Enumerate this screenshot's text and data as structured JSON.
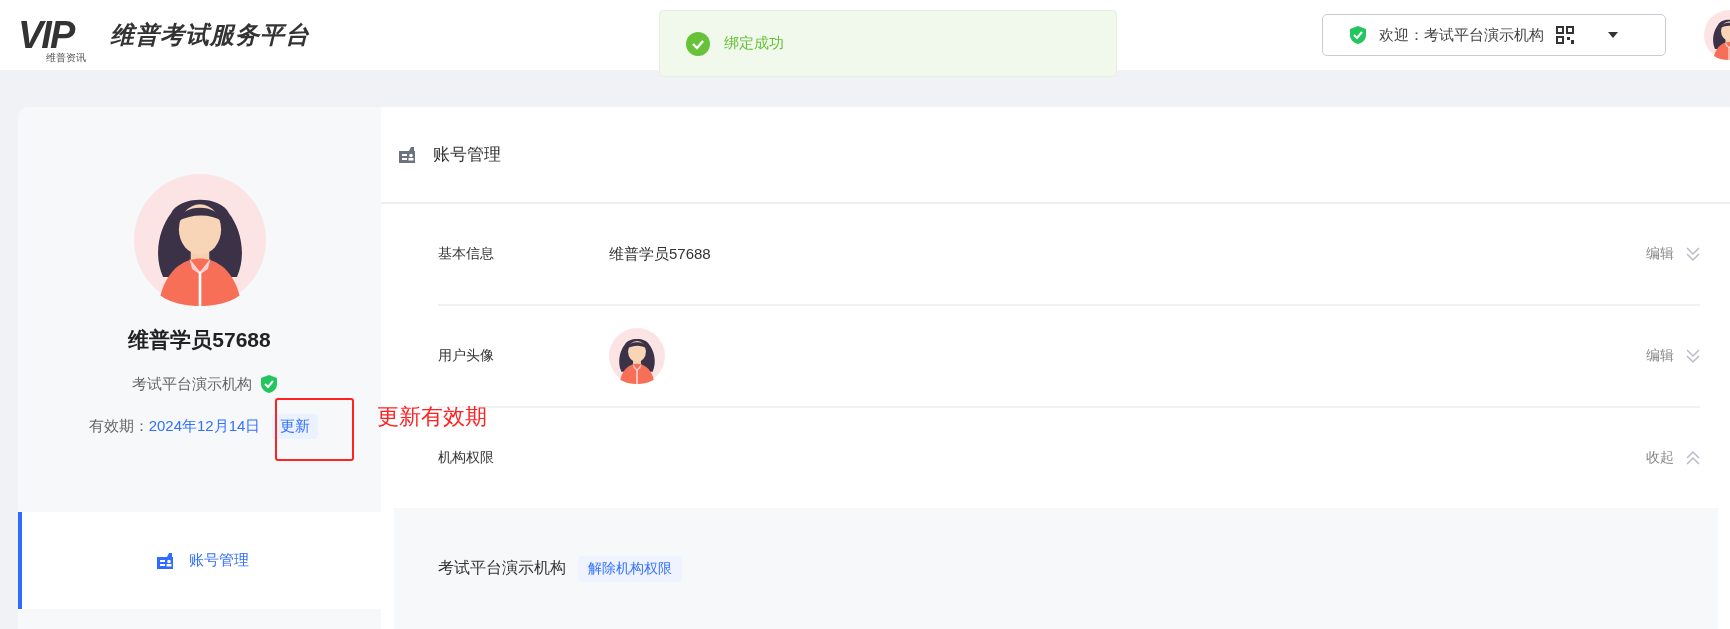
{
  "header": {
    "logo": {
      "mark": "VIP",
      "subtitle": "维普资讯"
    },
    "title": "维普考试服务平台",
    "welcome": "欢迎：考试平台演示机构"
  },
  "toast": {
    "kind": "success",
    "message": "绑定成功"
  },
  "profile": {
    "name": "维普学员57688",
    "organization": "考试平台演示机构",
    "verified": true,
    "validity_label": "有效期：",
    "validity_date": "2024年12月14日",
    "renew_button": "更新"
  },
  "annotation": {
    "text": "更新有效期"
  },
  "sidebar": {
    "items": [
      {
        "label": "账号管理",
        "selected": true
      }
    ]
  },
  "panel": {
    "title": "账号管理",
    "sections": [
      {
        "label": "基本信息",
        "kind": "text",
        "value": "维普学员57688",
        "action": "编辑",
        "expanded": false
      },
      {
        "label": "用户头像",
        "kind": "avatar",
        "action": "编辑",
        "expanded": false
      },
      {
        "label": "机构权限",
        "kind": "none",
        "action": "收起",
        "expanded": true,
        "organizations": [
          {
            "name": "考试平台演示机构",
            "action": "解除机构权限"
          }
        ]
      }
    ]
  }
}
